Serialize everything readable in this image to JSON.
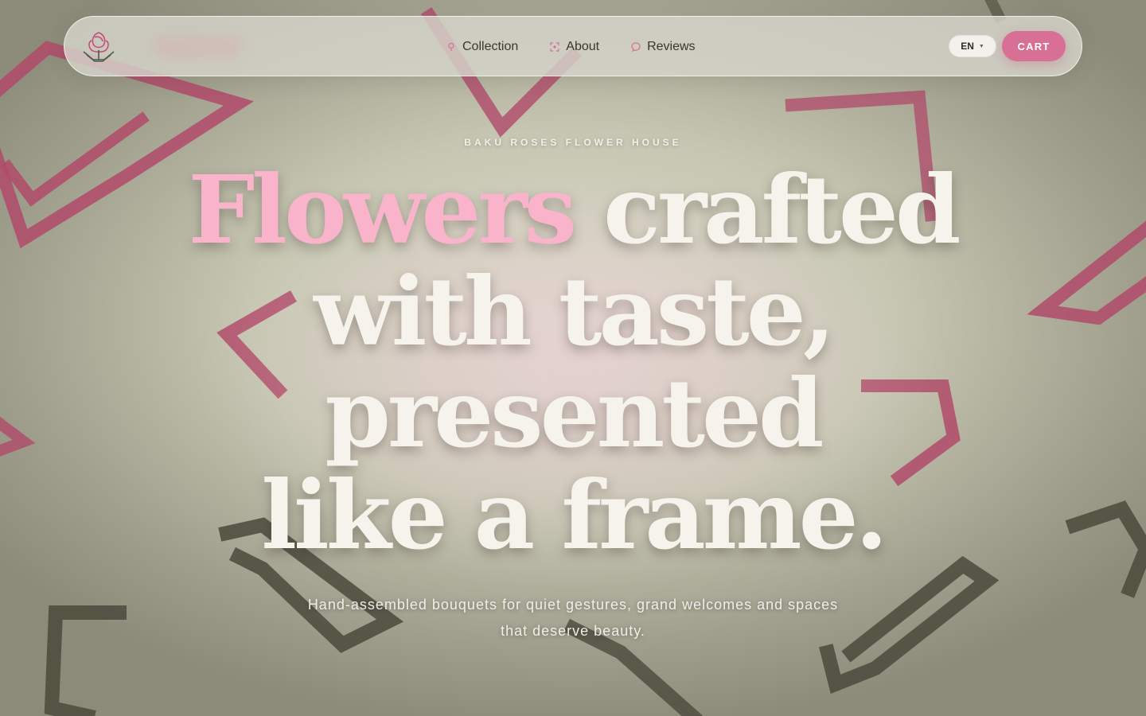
{
  "nav": {
    "links": [
      {
        "label": "Collection",
        "icon": "flower-icon"
      },
      {
        "label": "About",
        "icon": "frame-icon"
      },
      {
        "label": "Reviews",
        "icon": "chat-bubble-icon"
      }
    ],
    "language": "EN",
    "cart_label": "CART"
  },
  "hero": {
    "eyebrow": "BAKU ROSES FLOWER HOUSE",
    "headline_accent": "Flowers",
    "headline_rest_line1": "crafted",
    "headline_line2": "with taste,",
    "headline_line3": "presented",
    "headline_line4": "like a frame.",
    "subtitle": "Hand-assembled bouquets for quiet gestures, grand welcomes and spaces that deserve beauty."
  },
  "colors": {
    "accent_pink": "#d86f94",
    "headline_accent": "#f9b4cb",
    "shape_pink": "#b04a6a",
    "shape_dark": "#4a4a3c"
  }
}
